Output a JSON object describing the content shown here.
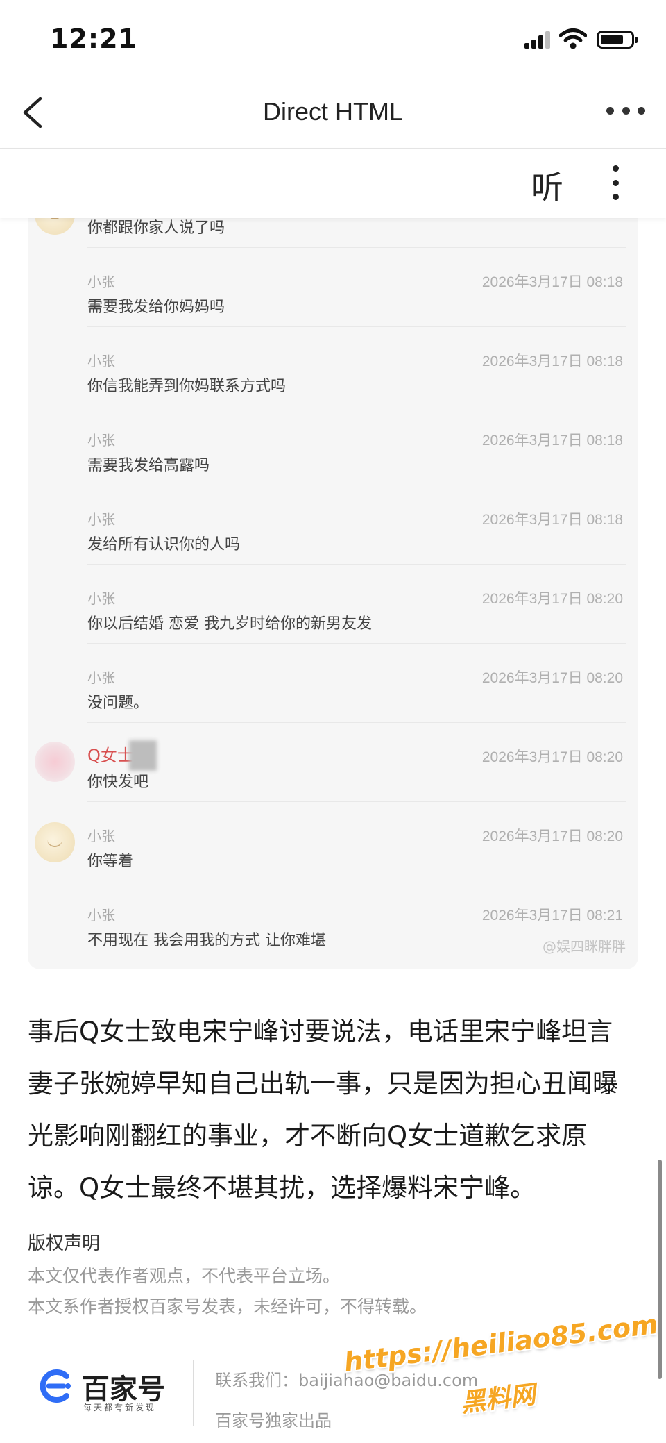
{
  "status_bar": {
    "time": "12:21",
    "battery_level": 0.75
  },
  "nav": {
    "title": "Direct HTML",
    "back_icon": "chevron-left-icon",
    "more_icon": "ellipsis-horizontal-icon"
  },
  "toolbar": {
    "listen_label": "听",
    "more_icon": "ellipsis-vertical-icon"
  },
  "chat": {
    "partial_top_text": "你都跟你家人说了吗",
    "messages": [
      {
        "name": "小张",
        "time": "2026年3月17日 08:18",
        "text": "需要我发给你妈妈吗"
      },
      {
        "name": "小张",
        "time": "2026年3月17日 08:18",
        "text": "你信我能弄到你妈联系方式吗"
      },
      {
        "name": "小张",
        "time": "2026年3月17日 08:18",
        "text": "需要我发给高露吗"
      },
      {
        "name": "小张",
        "time": "2026年3月17日 08:18",
        "text": "发给所有认识你的人吗"
      },
      {
        "name": "小张",
        "time": "2026年3月17日 08:20",
        "text": "你以后结婚 恋爱 我九岁时给你的新男友发"
      },
      {
        "name": "小张",
        "time": "2026年3月17日 08:20",
        "text": "没问题。"
      },
      {
        "name": "Q女士",
        "time": "2026年3月17日 08:20",
        "text": "你快发吧"
      },
      {
        "name": "小张",
        "time": "2026年3月17日 08:20",
        "text": "你等着"
      },
      {
        "name": "小张",
        "time": "2026年3月17日 08:21",
        "text": "不用现在 我会用我的方式 让你难堪"
      }
    ],
    "watermark": "@娱四眯胖胖"
  },
  "article": {
    "paragraph": "事后Q女士致电宋宁峰讨要说法，电话里宋宁峰坦言妻子张婉婷早知自己出轨一事，只是因为担心丑闻曝光影响刚翻红的事业，才不断向Q女士道歉乞求原谅。Q女士最终不堪其扰，选择爆料宋宁峰。"
  },
  "copyright": {
    "title": "版权声明",
    "line1": "本文仅代表作者观点，不代表平台立场。",
    "line2": "本文系作者授权百家号发表，未经许可，不得转载。"
  },
  "footer": {
    "brand": "百家号",
    "slogan": "每天都有新发现",
    "contact": "联系我们：baijiahao@baidu.com",
    "exclusive": "百家号独家出品"
  },
  "overlay_watermark": {
    "url": "https://heiliao85.com",
    "name": "黑料网"
  }
}
